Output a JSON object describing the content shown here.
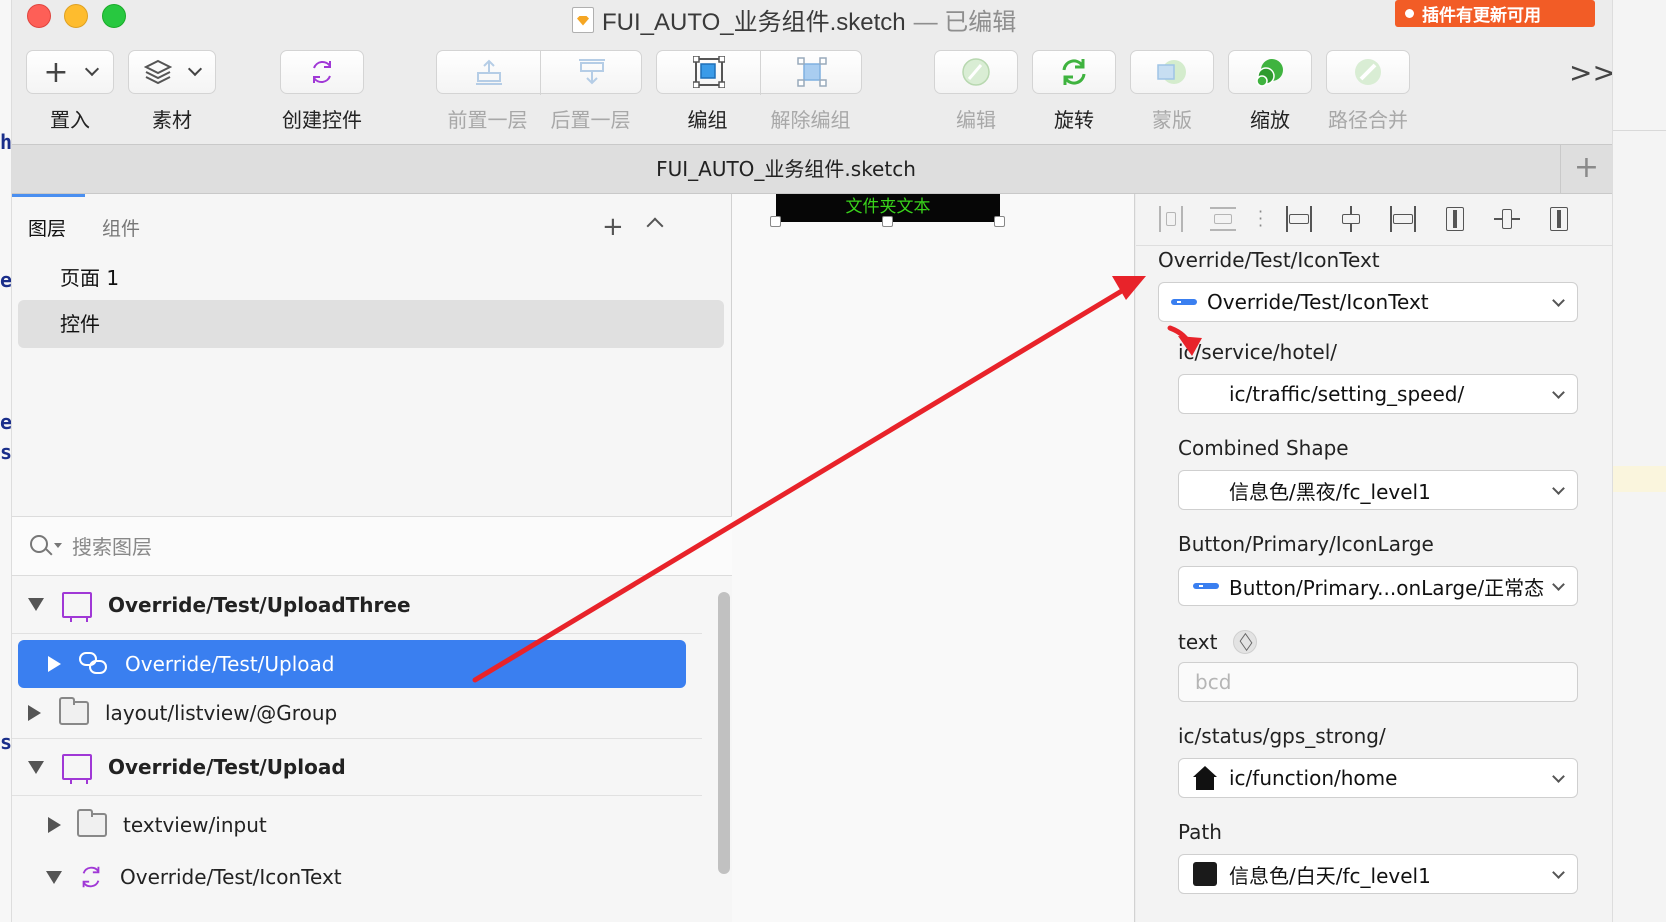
{
  "window": {
    "title": "FUI_AUTO_业务组件.sketch",
    "edited_suffix": "— 已编辑",
    "plugin_badge": "插件有更新可用"
  },
  "toolbar": {
    "insert_label": "置入",
    "assets_label": "素材",
    "create_symbol_label": "创建控件",
    "bring_forward_label": "前置一层",
    "send_backward_label": "后置一层",
    "group_label": "编组",
    "ungroup_label": "解除编组",
    "edit_label": "编辑",
    "rotate_label": "旋转",
    "mask_label": "蒙版",
    "scale_label": "缩放",
    "path_combine_label": "路径合并",
    "more_glyph": ">>"
  },
  "tabbar": {
    "document_tab": "FUI_AUTO_业务组件.sketch",
    "add_glyph": "+"
  },
  "left_panel": {
    "tabs": [
      "图层",
      "组件"
    ],
    "pages": [
      {
        "label": "页面 1"
      },
      {
        "label": "控件"
      }
    ],
    "search_placeholder": "搜索图层",
    "layers": [
      {
        "label": "Override/Test/UploadThree"
      },
      {
        "label": "Override/Test/Upload"
      },
      {
        "label": "layout/listview/@Group"
      },
      {
        "label": "Override/Test/Upload"
      },
      {
        "label": "textview/input"
      },
      {
        "label": "Override/Test/IconText"
      }
    ]
  },
  "canvas": {
    "element_text": "文件夹文本"
  },
  "inspector": {
    "symbol_label": "Override/Test/IconText",
    "symbol_value": "Override/Test/IconText",
    "overrides": [
      {
        "label": "ic/service/hotel/",
        "value": "ic/traffic/setting_speed/"
      },
      {
        "label": "Combined Shape",
        "value": "信息色/黑夜/fc_level1"
      },
      {
        "label": "Button/Primary/IconLarge",
        "value": "Button/Primary...onLarge/正常态"
      },
      {
        "label": "text",
        "placeholder": "bcd"
      },
      {
        "label": "ic/status/gps_strong/",
        "value": "ic/function/home"
      },
      {
        "label": "Path",
        "value": "信息色/白天/fc_level1"
      }
    ]
  },
  "colors": {
    "selection_blue": "#3a7ff0",
    "annotation_red": "#e8232a",
    "plugin_orange": "#f25c26",
    "artboard_purple": "#a038d6"
  }
}
